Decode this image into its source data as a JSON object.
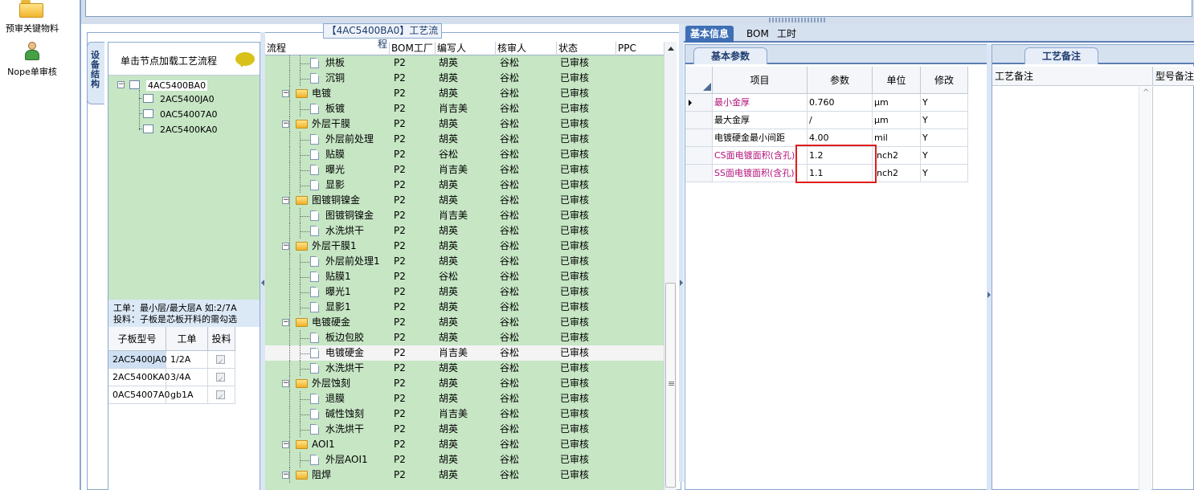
{
  "nav": {
    "item1_label": "预审关键物料",
    "item2_label": "Nope单审核"
  },
  "process_panel": {
    "title": "【4AC5400BA0】工艺流程",
    "vertical_tab": "设备结构"
  },
  "structure": {
    "hint": "单击节点加载工艺流程",
    "root": "4AC5400BA0",
    "children": [
      "2AC5400JA0",
      "0AC54007A0",
      "2AC5400KA0"
    ],
    "note_line1": "工单：最小层/最大层A 如:2/7A",
    "note_line2": "投料：子板是芯板开料的需勾选",
    "table": {
      "headers": [
        "子板型号",
        "工单",
        "投料"
      ],
      "rows": [
        {
          "model": "2AC5400JA0",
          "order": "1/2A",
          "feed": true
        },
        {
          "model": "2AC5400KA0",
          "order": "3/4A",
          "feed": true
        },
        {
          "model": "0AC54007A0",
          "order": "gb1A",
          "feed": true
        }
      ]
    }
  },
  "grid": {
    "headers": [
      "流程",
      "BOM工厂",
      "编写人",
      "核审人",
      "状态",
      "PPC"
    ],
    "rows": [
      {
        "level": 1,
        "name": "烘板",
        "plant": "P2",
        "writer": "胡英",
        "reviewer": "谷松",
        "status": "已审核"
      },
      {
        "level": 1,
        "name": "沉铜",
        "plant": "P2",
        "writer": "胡英",
        "reviewer": "谷松",
        "status": "已审核"
      },
      {
        "level": 0,
        "name": "电镀",
        "plant": "P2",
        "writer": "胡英",
        "reviewer": "谷松",
        "status": "已审核"
      },
      {
        "level": 1,
        "name": "板镀",
        "plant": "P2",
        "writer": "肖吉美",
        "reviewer": "谷松",
        "status": "已审核"
      },
      {
        "level": 0,
        "name": "外层干膜",
        "plant": "P2",
        "writer": "胡英",
        "reviewer": "谷松",
        "status": "已审核"
      },
      {
        "level": 1,
        "name": "外层前处理",
        "plant": "P2",
        "writer": "胡英",
        "reviewer": "谷松",
        "status": "已审核"
      },
      {
        "level": 1,
        "name": "贴膜",
        "plant": "P2",
        "writer": "谷松",
        "reviewer": "谷松",
        "status": "已审核"
      },
      {
        "level": 1,
        "name": "曝光",
        "plant": "P2",
        "writer": "肖吉美",
        "reviewer": "谷松",
        "status": "已审核"
      },
      {
        "level": 1,
        "name": "显影",
        "plant": "P2",
        "writer": "胡英",
        "reviewer": "谷松",
        "status": "已审核"
      },
      {
        "level": 0,
        "name": "图镀铜镍金",
        "plant": "P2",
        "writer": "胡英",
        "reviewer": "谷松",
        "status": "已审核"
      },
      {
        "level": 1,
        "name": "图镀铜镍金",
        "plant": "P2",
        "writer": "肖吉美",
        "reviewer": "谷松",
        "status": "已审核"
      },
      {
        "level": 1,
        "name": "水洗烘干",
        "plant": "P2",
        "writer": "胡英",
        "reviewer": "谷松",
        "status": "已审核"
      },
      {
        "level": 0,
        "name": "外层干膜1",
        "plant": "P2",
        "writer": "胡英",
        "reviewer": "谷松",
        "status": "已审核"
      },
      {
        "level": 1,
        "name": "外层前处理1",
        "plant": "P2",
        "writer": "胡英",
        "reviewer": "谷松",
        "status": "已审核"
      },
      {
        "level": 1,
        "name": "贴膜1",
        "plant": "P2",
        "writer": "谷松",
        "reviewer": "谷松",
        "status": "已审核"
      },
      {
        "level": 1,
        "name": "曝光1",
        "plant": "P2",
        "writer": "胡英",
        "reviewer": "谷松",
        "status": "已审核"
      },
      {
        "level": 1,
        "name": "显影1",
        "plant": "P2",
        "writer": "胡英",
        "reviewer": "谷松",
        "status": "已审核"
      },
      {
        "level": 0,
        "name": "电镀硬金",
        "plant": "P2",
        "writer": "胡英",
        "reviewer": "谷松",
        "status": "已审核"
      },
      {
        "level": 1,
        "name": "板边包胶",
        "plant": "P2",
        "writer": "胡英",
        "reviewer": "谷松",
        "status": "已审核"
      },
      {
        "level": 1,
        "name": "电镀硬金",
        "plant": "P2",
        "writer": "肖吉美",
        "reviewer": "谷松",
        "status": "已审核",
        "selected": true
      },
      {
        "level": 1,
        "name": "水洗烘干",
        "plant": "P2",
        "writer": "胡英",
        "reviewer": "谷松",
        "status": "已审核"
      },
      {
        "level": 0,
        "name": "外层蚀刻",
        "plant": "P2",
        "writer": "胡英",
        "reviewer": "谷松",
        "status": "已审核"
      },
      {
        "level": 1,
        "name": "退膜",
        "plant": "P2",
        "writer": "胡英",
        "reviewer": "谷松",
        "status": "已审核"
      },
      {
        "level": 1,
        "name": "碱性蚀刻",
        "plant": "P2",
        "writer": "肖吉美",
        "reviewer": "谷松",
        "status": "已审核"
      },
      {
        "level": 1,
        "name": "水洗烘干",
        "plant": "P2",
        "writer": "胡英",
        "reviewer": "谷松",
        "status": "已审核"
      },
      {
        "level": 0,
        "name": "AOI1",
        "plant": "P2",
        "writer": "胡英",
        "reviewer": "谷松",
        "status": "已审核"
      },
      {
        "level": 1,
        "name": "外层AOI1",
        "plant": "P2",
        "writer": "胡英",
        "reviewer": "谷松",
        "status": "已审核"
      },
      {
        "level": 0,
        "name": "阻焊",
        "plant": "P2",
        "writer": "胡英",
        "reviewer": "谷松",
        "status": "已审核"
      }
    ]
  },
  "right": {
    "tabs": [
      "基本信息",
      "BOM",
      "工时"
    ],
    "subtab": "基本参数",
    "param_headers": [
      "项目",
      "参数",
      "单位",
      "修改"
    ],
    "params": [
      {
        "item": "最小金厚",
        "value": "0.760",
        "unit": "μm",
        "edit": "Y",
        "highlight": true,
        "current": true
      },
      {
        "item": "最大金厚",
        "value": "/",
        "unit": "μm",
        "edit": "Y",
        "highlight": false
      },
      {
        "item": "电镀硬金最小间距",
        "value": "4.00",
        "unit": "mil",
        "edit": "Y",
        "highlight": false
      },
      {
        "item": "CS面电镀面积(含孔)",
        "value": "1.2",
        "unit": "inch2",
        "edit": "Y",
        "highlight": true
      },
      {
        "item": "SS面电镀面积(含孔)",
        "value": "1.1",
        "unit": "inch2",
        "edit": "Y",
        "highlight": true
      }
    ],
    "notes_tab": "工艺备注",
    "notes_headers": [
      "工艺备注",
      "型号备注"
    ]
  },
  "colors": {
    "grid_bg": "#c6e6c4",
    "accent": "#3f6fb5",
    "highlight_text": "#b0137a",
    "red_box": "#e01d1d"
  }
}
